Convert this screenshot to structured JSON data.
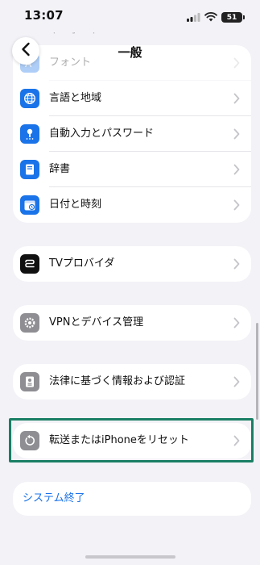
{
  "status_bar": {
    "time": "13:07",
    "battery": "51"
  },
  "nav": {
    "title": "一般",
    "back_icon": "chevron-left-icon"
  },
  "ghost_rows": {
    "keyboard": "キーボード"
  },
  "groups": {
    "locale": [
      {
        "label": "フォント",
        "icon": "font-icon",
        "color": "#1a73e8",
        "faded": true
      },
      {
        "label": "言語と地域",
        "icon": "globe-icon",
        "color": "#1a73e8"
      },
      {
        "label": "自動入力とパスワード",
        "icon": "key-icon",
        "color": "#1a73e8"
      },
      {
        "label": "辞書",
        "icon": "book-icon",
        "color": "#1a73e8"
      },
      {
        "label": "日付と時刻",
        "icon": "calendar-icon",
        "color": "#1a73e8"
      }
    ],
    "tv": {
      "label": "TVプロバイダ",
      "icon": "tv-provider-icon",
      "color": "#111111"
    },
    "vpn": {
      "label": "VPNとデバイス管理",
      "icon": "gear-icon",
      "color": "#8e8e93"
    },
    "legal": {
      "label": "法律に基づく情報および認証",
      "icon": "certificate-icon",
      "color": "#8e8e93"
    },
    "reset": {
      "label": "転送またはiPhoneをリセット",
      "icon": "reset-icon",
      "color": "#8e8e93"
    },
    "shutdown": {
      "label": "システム終了"
    }
  },
  "colors": {
    "accent": "#1a73e8",
    "highlight": "#1a7f64",
    "background": "#f2f2f7"
  }
}
